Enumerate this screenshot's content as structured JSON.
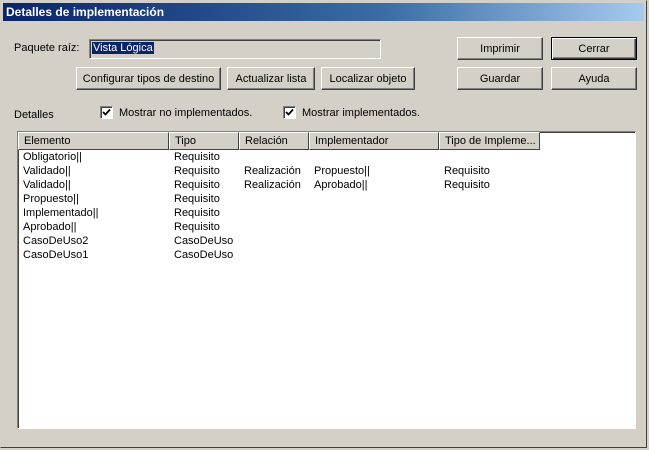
{
  "window": {
    "title": "Detalles de implementación"
  },
  "root_package": {
    "label": "Paquete raíz:",
    "value": "Vista Lógica"
  },
  "buttons": {
    "print": "Imprimir",
    "close": "Cerrar",
    "save": "Guardar",
    "help": "Ayuda",
    "configure": "Configurar tipos de destino",
    "refresh": "Actualizar lista",
    "locate": "Localizar objeto"
  },
  "details": {
    "label": "Detalles",
    "show_not_implemented": {
      "label": "Mostrar no implementados.",
      "checked": true
    },
    "show_implemented": {
      "label": "Mostrar implementados.",
      "checked": true
    }
  },
  "table": {
    "columns": [
      "Elemento",
      "Tipo",
      "Relación",
      "Implementador",
      "Tipo de Impleme..."
    ],
    "rows": [
      [
        "Obligatorio||",
        "Requisito",
        "",
        "",
        ""
      ],
      [
        "Validado||",
        "Requisito",
        "Realización",
        "Propuesto||",
        "Requisito"
      ],
      [
        "Validado||",
        "Requisito",
        "Realización",
        "Aprobado||",
        "Requisito"
      ],
      [
        "Propuesto||",
        "Requisito",
        "",
        "",
        ""
      ],
      [
        "Implementado||",
        "Requisito",
        "",
        "",
        ""
      ],
      [
        "Aprobado||",
        "Requisito",
        "",
        "",
        ""
      ],
      [
        "CasoDeUso2",
        "CasoDeUso",
        "",
        "",
        ""
      ],
      [
        "CasoDeUso1",
        "CasoDeUso",
        "",
        "",
        ""
      ]
    ]
  }
}
